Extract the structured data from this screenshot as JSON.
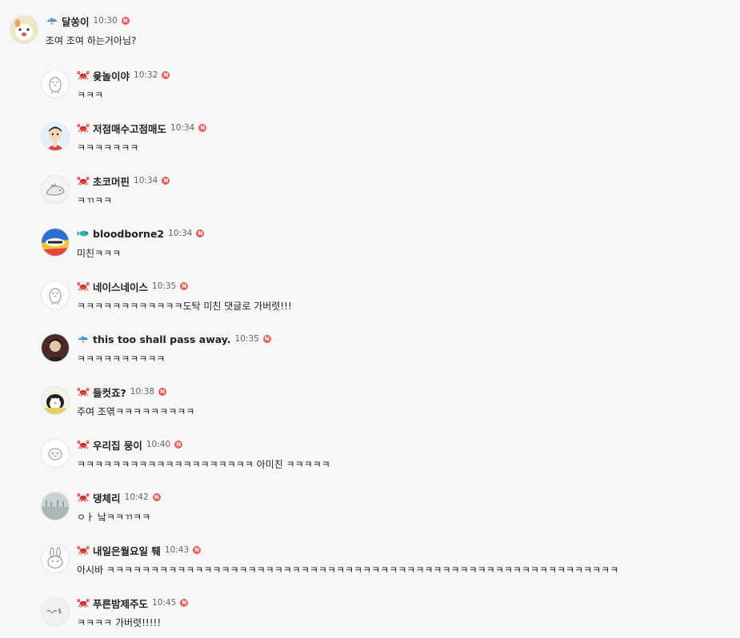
{
  "comments": [
    {
      "nickname": "달쏭이",
      "time": "10:30",
      "badge": "N",
      "text": "조여 조여 하는거아님?",
      "level_icon": "blue-mushroom-icon",
      "avatar_icon": "cartoon-face-avatar",
      "reply": false
    },
    {
      "nickname": "윷놀이야",
      "time": "10:32",
      "badge": "N",
      "text": "ㅋㅋㅋ",
      "level_icon": "red-crab-icon",
      "avatar_icon": "default-penguin-avatar",
      "reply": true
    },
    {
      "nickname": "저점매수고점매도",
      "time": "10:34",
      "badge": "N",
      "text": "ㅋㅋㅋㅋㅋㅋㅋ",
      "level_icon": "red-crab-icon",
      "avatar_icon": "cartoon-character-avatar",
      "reply": true
    },
    {
      "nickname": "초코머핀",
      "time": "10:34",
      "badge": "N",
      "text": "ㅋㄲㅋㅋ",
      "level_icon": "red-crab-icon",
      "avatar_icon": "sketch-dinosaur-avatar",
      "reply": true
    },
    {
      "nickname": "bloodborne2",
      "time": "10:34",
      "badge": "N",
      "text": "미친ㅋㅋㅋ",
      "level_icon": "teal-fish-icon",
      "avatar_icon": "colorful-logo-avatar",
      "reply": true
    },
    {
      "nickname": "네이스네이스",
      "time": "10:35",
      "badge": "N",
      "text": "ㅋㅋㅋㅋㅋㅋㅋㅋㅋㅋㅋㅋ도탁 미친 댓글로 가버렷!!!",
      "level_icon": "red-crab-icon",
      "avatar_icon": "default-penguin-avatar",
      "reply": true
    },
    {
      "nickname": "this too shall pass away.",
      "time": "10:35",
      "badge": "N",
      "text": "ㅋㅋㅋㅋㅋㅋㅋㅋㅋㅋ",
      "level_icon": "blue-mushroom-icon",
      "avatar_icon": "person-photo-avatar",
      "reply": true
    },
    {
      "nickname": "들컷죠?",
      "time": "10:38",
      "badge": "N",
      "text": "주여 조엮ㅋㅋㅋㅋㅋㅋㅋㅋㅋ",
      "level_icon": "red-crab-icon",
      "avatar_icon": "penguin-character-avatar",
      "reply": true
    },
    {
      "nickname": "우리집 뭉이",
      "time": "10:40",
      "badge": "N",
      "text": "ㅋㅋㅋㅋㅋㅋㅋㅋㅋㅋㅋㅋㅋㅋㅋㅋㅋㅋㅋㅋ 아미친 ㅋㅋㅋㅋㅋ",
      "level_icon": "red-crab-icon",
      "avatar_icon": "cute-face-avatar",
      "reply": true
    },
    {
      "nickname": "댕체리",
      "time": "10:42",
      "badge": "N",
      "text": "ㅇㅏ 낰ㅋㅋㄲㅋㅋ",
      "level_icon": "red-crab-icon",
      "avatar_icon": "landscape-photo-avatar",
      "reply": true
    },
    {
      "nickname": "내일은월요일 퉤",
      "time": "10:43",
      "badge": "N",
      "text": "아시바 ㅋㅋㅋㅋㅋㅋㅋㅋㅋㅋㅋㅋㅋㅋㅋㅋㅋㅋㅋㅋㅋㅋㅋㅋㅋㅋㅋㅋㅋㅋㅋㅋㅋㅋㅋㅋㅋㅋㅋㅋㅋㅋㅋㅋㅋㅋㅋㅋㅋㅋㅋㅋㅋㅋㅋㅋㅋㅋ",
      "level_icon": "red-crab-icon",
      "avatar_icon": "rabbit-sketch-avatar",
      "reply": true
    },
    {
      "nickname": "푸른밤제주도",
      "time": "10:45",
      "badge": "N",
      "text": "ㅋㅋㅋㅋ 가버렷!!!!!",
      "level_icon": "red-crab-icon",
      "avatar_icon": "handwriting-avatar",
      "reply": true
    }
  ],
  "colors": {
    "background": "#f7f7f7",
    "badge": "#f05a5a",
    "crab": "#e8413c",
    "mushroom": "#3b8fd8",
    "fish": "#2bb3a8",
    "time": "#666666"
  }
}
